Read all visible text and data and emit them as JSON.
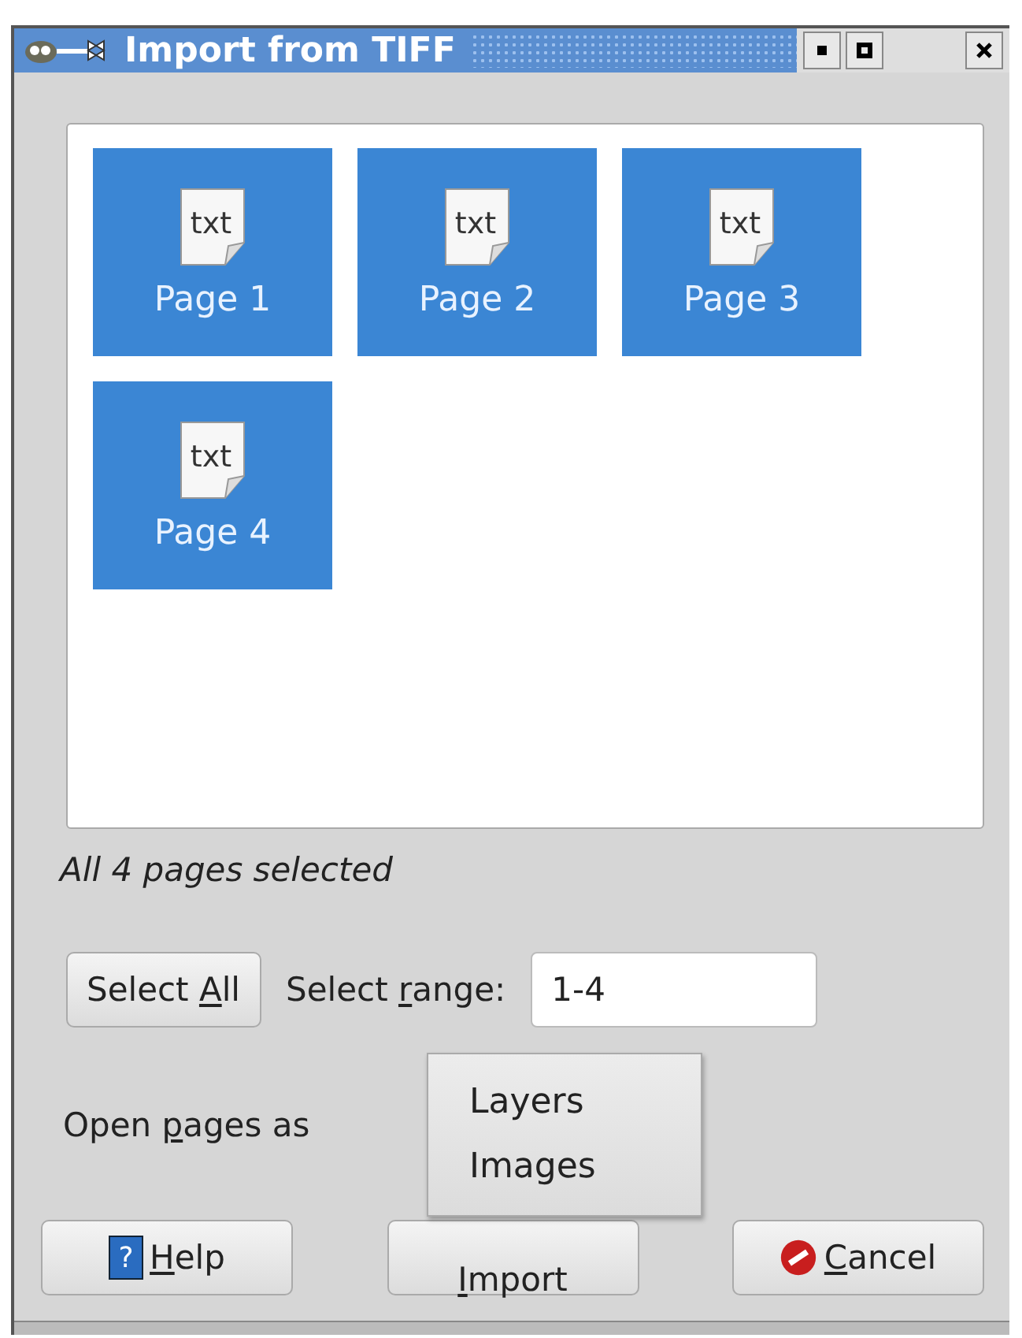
{
  "window": {
    "title": "Import from TIFF"
  },
  "pages": [
    {
      "label": "Page 1",
      "icon_text": "txt",
      "selected": true
    },
    {
      "label": "Page 2",
      "icon_text": "txt",
      "selected": true
    },
    {
      "label": "Page 3",
      "icon_text": "txt",
      "selected": true
    },
    {
      "label": "Page 4",
      "icon_text": "txt",
      "selected": true
    }
  ],
  "status": "All 4 pages selected",
  "select_all": {
    "label_parts": [
      {
        "text": "Select ",
        "underlined": false
      },
      {
        "text": "A",
        "underlined": true
      },
      {
        "text": "ll",
        "underlined": false
      }
    ]
  },
  "range": {
    "label_parts": [
      {
        "text": "Select ",
        "underlined": false
      },
      {
        "text": "r",
        "underlined": true
      },
      {
        "text": "ange:",
        "underlined": false
      }
    ],
    "value": "1-4"
  },
  "open_as": {
    "label_parts": [
      {
        "text": "Open ",
        "underlined": false
      },
      {
        "text": "p",
        "underlined": true
      },
      {
        "text": "ages as",
        "underlined": false
      }
    ],
    "menu": [
      {
        "label": "Layers"
      },
      {
        "label": "Images"
      }
    ]
  },
  "buttons": [
    {
      "kind": "help",
      "icon_text": "?",
      "label_parts": [
        {
          "text": "H",
          "underlined": true
        },
        {
          "text": "elp",
          "underlined": false
        }
      ]
    },
    {
      "kind": "import",
      "label_parts": [
        {
          "text": "I",
          "underlined": true
        },
        {
          "text": "mport",
          "underlined": false
        }
      ]
    },
    {
      "kind": "cancel",
      "label_parts": [
        {
          "text": "C",
          "underlined": true
        },
        {
          "text": "ancel",
          "underlined": false
        }
      ]
    }
  ]
}
